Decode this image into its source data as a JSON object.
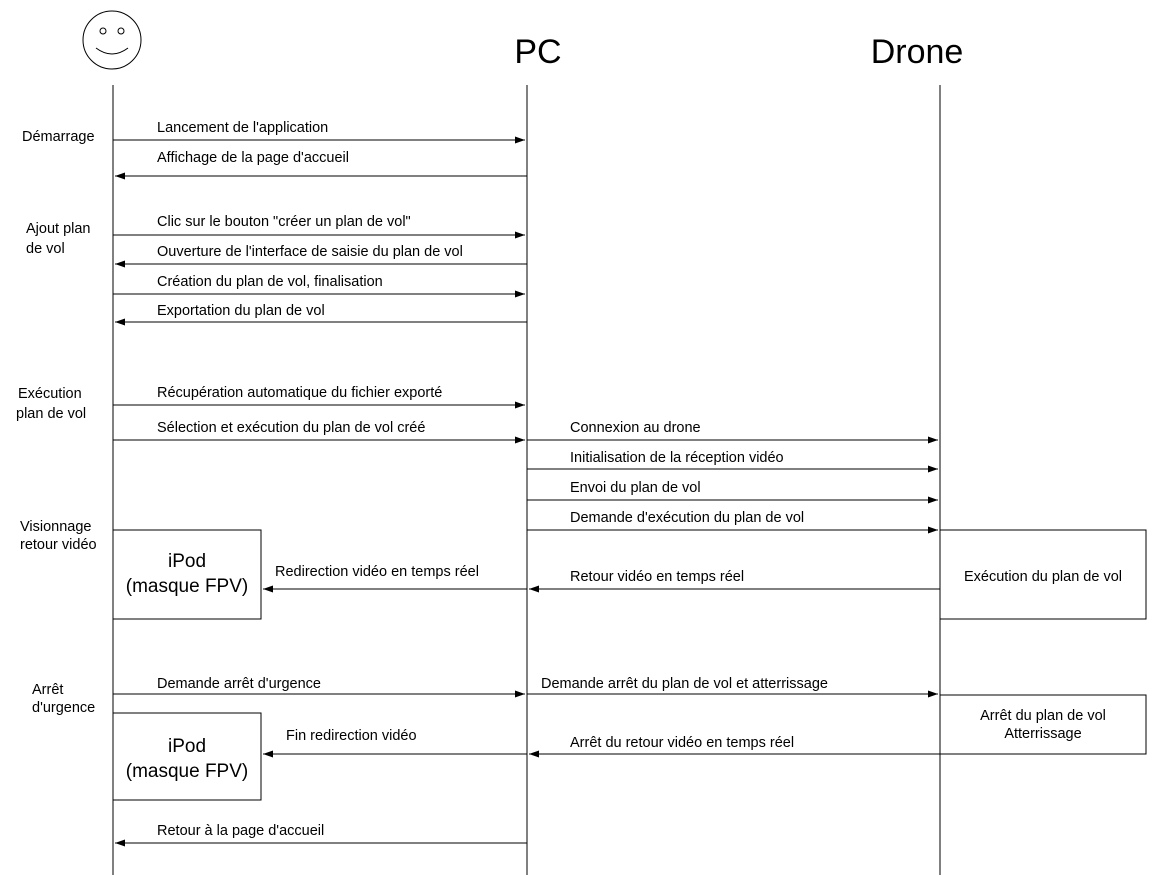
{
  "participants": {
    "pc": "PC",
    "drone": "Drone"
  },
  "actor_icon": "smiley-face-icon",
  "phases": {
    "demarrage": "Démarrage",
    "ajout_1": "Ajout plan",
    "ajout_2": "de vol",
    "execution_1": "Exécution",
    "execution_2": "plan de vol",
    "visionnage_1": "Visionnage",
    "visionnage_2": "retour vidéo",
    "arret_1": "Arrêt",
    "arret_2": "d'urgence"
  },
  "messages": {
    "m1": "Lancement de l'application",
    "m2": "Affichage de la page d'accueil",
    "m3": "Clic sur le bouton \"créer un plan de vol\"",
    "m4": "Ouverture de l'interface de saisie du plan de vol",
    "m5": "Création du plan de vol, finalisation",
    "m6": "Exportation du plan de vol",
    "m7": "Récupération automatique du fichier exporté",
    "m8": "Sélection et exécution du plan de vol créé",
    "m9": "Connexion au drone",
    "m10": "Initialisation de la réception vidéo",
    "m11": "Envoi du plan de vol",
    "m12": "Demande d'exécution du plan de vol",
    "m13": "Retour vidéo en temps réel",
    "m14": "Redirection vidéo en temps réel",
    "m15": "Demande arrêt d'urgence",
    "m16": "Demande arrêt du plan de vol et atterrissage",
    "m17": "Arrêt du retour vidéo en temps réel",
    "m18": "Fin redirection vidéo",
    "m19": "Retour à la page d'accueil"
  },
  "boxes": {
    "ipod1_line1": "iPod",
    "ipod1_line2": "(masque FPV)",
    "ipod2_line1": "iPod",
    "ipod2_line2": "(masque FPV)",
    "exec_drone": "Exécution du plan de vol",
    "arret_drone_1": "Arrêt du plan de vol",
    "arret_drone_2": "Atterrissage"
  }
}
